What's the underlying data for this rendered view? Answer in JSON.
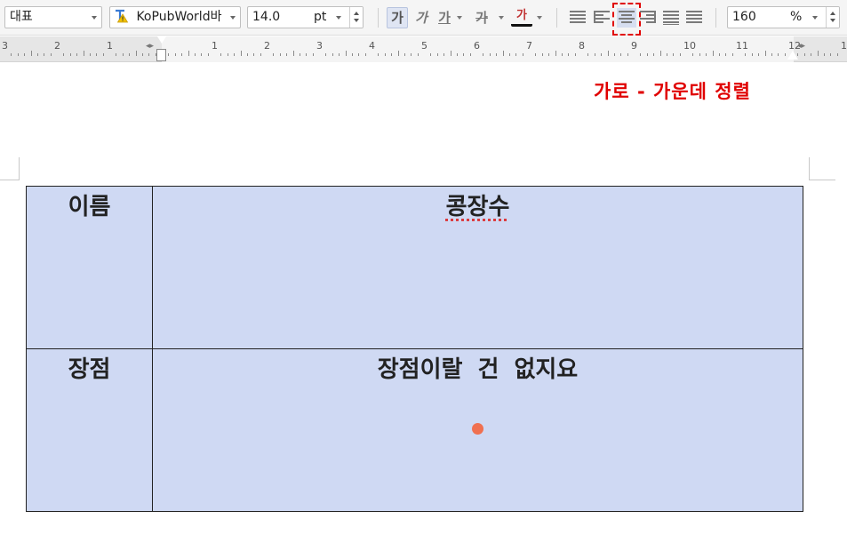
{
  "toolbar": {
    "style": "대표",
    "font": "KoPubWorld바",
    "font_size": "14.0",
    "size_unit": "pt",
    "format_buttons": [
      "가",
      "가",
      "가",
      "가",
      "가"
    ],
    "zoom": "160",
    "zoom_unit": "%"
  },
  "ruler": {
    "left_numbers": [
      "3",
      "2",
      "1"
    ],
    "right_numbers": [
      "1",
      "2",
      "3",
      "4",
      "5",
      "6",
      "7",
      "8",
      "9",
      "10",
      "11",
      "12",
      "13"
    ]
  },
  "annotation": "가로 - 가운데 정렬",
  "table": {
    "rows": [
      {
        "label": "이름",
        "value": "콩장수"
      },
      {
        "label": "장점",
        "value": "장점이랄 건 없지요"
      }
    ]
  },
  "colors": {
    "table_bg": "#cfd9f3",
    "annotation": "#e00000",
    "highlight_box": "#e00000",
    "cursor_dot": "#f07050"
  },
  "icons": [
    "font-warning-icon",
    "align-justify-icon",
    "align-left-icon",
    "align-center-icon",
    "align-right-icon",
    "align-distribute-icon",
    "align-split-icon"
  ]
}
